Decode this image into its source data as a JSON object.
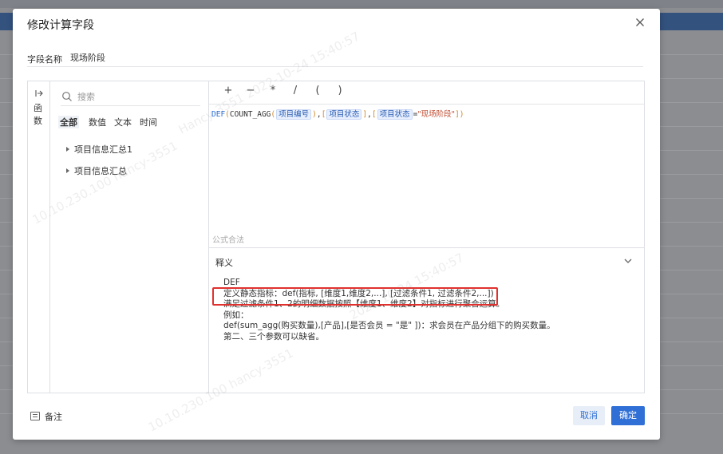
{
  "dialog": {
    "title": "修改计算字段",
    "field_label": "字段名称",
    "field_value": "现场阶段",
    "functions_label": "函数",
    "search_placeholder": "搜索",
    "filter_tabs": [
      "全部",
      "数值",
      "文本",
      "时间"
    ],
    "tree_items": [
      "项目信息汇总1",
      "项目信息汇总"
    ],
    "operators": [
      "+",
      "−",
      "*",
      "/",
      "(",
      ")"
    ],
    "formula": {
      "func": "DEF",
      "inner_func": "COUNT_AGG",
      "tag1": "项目编号",
      "tag2": "项目状态",
      "tag3": "项目状态",
      "eq": "=",
      "string": "\"现场阶段\""
    },
    "syntax_hint": "公式合法",
    "explain_title": "释义",
    "explain_lines": [
      "DEF",
      "定义静态指标：def(指标, [维度1,维度2,...], [过滤条件1, 过滤条件2,...])",
      "满足过滤条件1、2的明细数据按照【维度1、维度2】对指标进行聚合运算。",
      "例如：",
      "def(sum_agg(购买数量),[产品],[是否会员 = \"是\" ])：求会员在产品分组下的购买数量。",
      "第二、三个参数可以缺省。"
    ],
    "note_label": "备注",
    "cancel_label": "取消",
    "ok_label": "确定"
  },
  "watermarks": [
    "Hancy-3551  2022-10-24  15:40:57",
    "10.10.230.100  hancy-3551",
    "2022-10-24  15:40:57",
    "10.10.230.100  hancy-3551"
  ],
  "colors": {
    "accent": "#2f6fd6",
    "highlight_border": "#e0312e",
    "overlay_bg": "#8b8d91"
  }
}
